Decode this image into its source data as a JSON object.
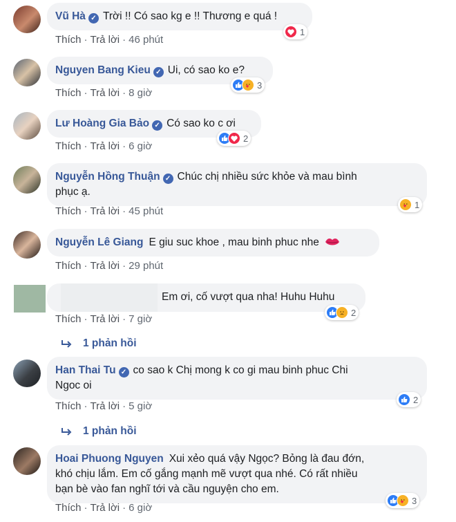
{
  "comments": [
    {
      "name": "Vũ Hà",
      "text": "Trời !! Có sao kg e !! Thương e quá !",
      "like": "Thích",
      "reply": "Trả lời",
      "time": "46 phút",
      "reaction_count": "1"
    },
    {
      "name": "Nguyen Bang Kieu",
      "text": "Ui, có sao ko e?",
      "like": "Thích",
      "reply": "Trả lời",
      "time": "8 giờ",
      "reaction_count": "3"
    },
    {
      "name": "Lư Hoàng Gia Bảo",
      "text": "Có sao ko c ơi",
      "like": "Thích",
      "reply": "Trả lời",
      "time": "6 giờ",
      "reaction_count": "2"
    },
    {
      "name": "Nguyễn Hồng Thuận",
      "text_line1": "Chúc chị nhiều sức khỏe và mau bình",
      "text_line2": "phục ạ.",
      "like": "Thích",
      "reply": "Trả lời",
      "time": "45 phút",
      "reaction_count": "1"
    },
    {
      "name": "Nguyễn Lê Giang",
      "text": "E giu suc khoe , mau binh phuc nhe",
      "like": "Thích",
      "reply": "Trả lời",
      "time": "29 phút"
    },
    {
      "name": "",
      "text": "Em ơi, cố vượt qua nha! Huhu Huhu",
      "like": "Thích",
      "reply": "Trả lời",
      "time": "7 giờ",
      "reaction_count": "2",
      "replies": "1 phản hồi"
    },
    {
      "name": "Han Thai Tu",
      "text_line1": "co sao k Chị mong k co gi mau binh phuc Chi",
      "text_line2": "Ngoc oi",
      "like": "Thích",
      "reply": "Trả lời",
      "time": "5 giờ",
      "reaction_count": "2",
      "replies": "1 phản hồi"
    },
    {
      "name": "Hoai Phuong Nguyen",
      "text_line1": "Xui xẻo quá vậy Ngọc? Bỏng là đau đớn,",
      "text_line2": "khó chịu lắm. Em cố gắng mạnh mẽ vượt qua nhé. Có rất nhiều",
      "text_line3": "bạn bè vào fan nghĩ tới và cầu nguyện cho em.",
      "like": "Thích",
      "reply": "Trả lời",
      "time": "6 giờ",
      "reaction_count": "3"
    }
  ],
  "colors": {
    "link": "#385898",
    "bubble": "#f2f3f5",
    "like": "#2e7df6",
    "love": "#f0284a",
    "care": "#f7b125"
  }
}
